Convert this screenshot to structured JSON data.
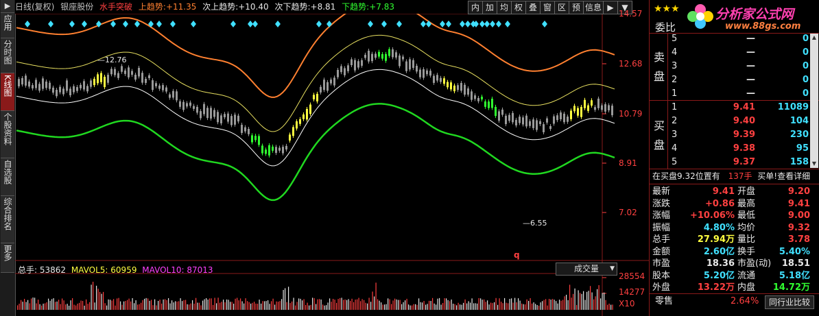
{
  "colors": {
    "bull": "#ff4040",
    "bear": "#30ff30",
    "up_price": "#ff4040",
    "down_price": "#30ff30",
    "label_cyan": "#40e0ff",
    "orange": "#ff8030",
    "lime": "#20d820",
    "ylw": "#e8e060",
    "wht": "#ffffff"
  },
  "left_sidebar": {
    "tabs": [
      {
        "label": "应用",
        "active": false
      },
      {
        "label": "分时图",
        "active": false
      },
      {
        "label": "K线图",
        "active": true
      },
      {
        "label": "个股资料",
        "active": false
      },
      {
        "label": "自选股",
        "active": false
      },
      {
        "label": "综合排名",
        "active": false
      },
      {
        "label": "更多",
        "active": false
      }
    ]
  },
  "header": {
    "period": "日线(复权)",
    "stock_name": "银座股份",
    "indicator": "水手突破",
    "up_trend_label": "上趋势:",
    "up_trend_value": "+11.35",
    "next_up_label": "次上趋势:",
    "next_up_value": "+10.40",
    "next_down_label": "次下趋势:",
    "next_down_value": "+8.81",
    "down_trend_label": "下趋势:",
    "down_trend_value": "+7.83",
    "tools": [
      "内",
      "加",
      "均",
      "权",
      "叠",
      "窗",
      "区",
      "预",
      "信息",
      "▶",
      "▼"
    ]
  },
  "price_axis": {
    "labels": [
      "14.57",
      "12.68",
      "10.79",
      "8.91",
      "7.02"
    ]
  },
  "annotations": {
    "high": "12.76",
    "low": "6.55",
    "mark": "q"
  },
  "volume_panel": {
    "label": "总手: 53862",
    "mavol5": "MAVOL5: 60959",
    "mavol10": "MAVOL10: 87013",
    "selector": "成交量",
    "axis": [
      "28554",
      "14277",
      "X10"
    ]
  },
  "right_panel": {
    "stars": "★★★",
    "logo_text": "分析家公式网",
    "logo_url_text": "www.88gs.com",
    "webi_label": "委比",
    "sell_label": "卖盘",
    "buy_label": "买盘",
    "sell_orders": [
      {
        "level": "5",
        "price": "—",
        "vol": "0"
      },
      {
        "level": "4",
        "price": "—",
        "vol": "0"
      },
      {
        "level": "3",
        "price": "—",
        "vol": "0"
      },
      {
        "level": "2",
        "price": "—",
        "vol": "0"
      },
      {
        "level": "1",
        "price": "—",
        "vol": "0"
      }
    ],
    "buy_orders": [
      {
        "level": "1",
        "price": "9.41",
        "vol": "11089"
      },
      {
        "level": "2",
        "price": "9.40",
        "vol": "104"
      },
      {
        "level": "3",
        "price": "9.39",
        "vol": "230"
      },
      {
        "level": "4",
        "price": "9.38",
        "vol": "95"
      },
      {
        "level": "5",
        "price": "9.37",
        "vol": "158"
      }
    ],
    "notice": "在买盘9.32位置有",
    "notice_vol": "137手",
    "notice_action": "买单!查看详细",
    "stats": [
      {
        "l1": "最新",
        "v1": "9.41",
        "c1": "red",
        "l2": "开盘",
        "v2": "9.20",
        "c2": "red"
      },
      {
        "l1": "涨跌",
        "v1": "+0.86",
        "c1": "red",
        "l2": "最高",
        "v2": "9.41",
        "c2": "red"
      },
      {
        "l1": "涨幅",
        "v1": "+10.06%",
        "c1": "red",
        "l2": "最低",
        "v2": "9.00",
        "c2": "red"
      },
      {
        "l1": "振幅",
        "v1": "4.80%",
        "c1": "cyan",
        "l2": "均价",
        "v2": "9.32",
        "c2": "red"
      },
      {
        "l1": "总手",
        "v1": "27.94万",
        "c1": "yellow",
        "l2": "量比",
        "v2": "3.78",
        "c2": "red"
      },
      {
        "l1": "金额",
        "v1": "2.60亿",
        "c1": "cyan",
        "l2": "换手",
        "v2": "5.40%",
        "c2": "cyan"
      },
      {
        "l1": "市盈",
        "v1": "18.36",
        "c1": "white",
        "l2": "市盈(动)",
        "v2": "18.51",
        "c2": "white"
      },
      {
        "l1": "股本",
        "v1": "5.20亿",
        "c1": "cyan",
        "l2": "流通",
        "v2": "5.18亿",
        "c2": "cyan"
      },
      {
        "l1": "外盘",
        "v1": "13.22万",
        "c1": "red",
        "l2": "内盘",
        "v2": "14.72万",
        "c2": "green"
      }
    ],
    "footer_label": "零售",
    "footer_value": "2.64%",
    "footer_button": "同行业比较"
  }
}
